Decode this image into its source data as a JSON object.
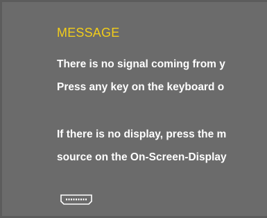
{
  "osd": {
    "title": "MESSAGE",
    "lines": [
      "There is no signal coming from y",
      "Press any key on the keyboard o",
      "If there is no display, press the m",
      "source on the On-Screen-Display"
    ],
    "icon": "display-port-icon",
    "colors": {
      "background": "#6b6b6b",
      "title": "#f2cd1a",
      "text": "#ffffff"
    }
  }
}
